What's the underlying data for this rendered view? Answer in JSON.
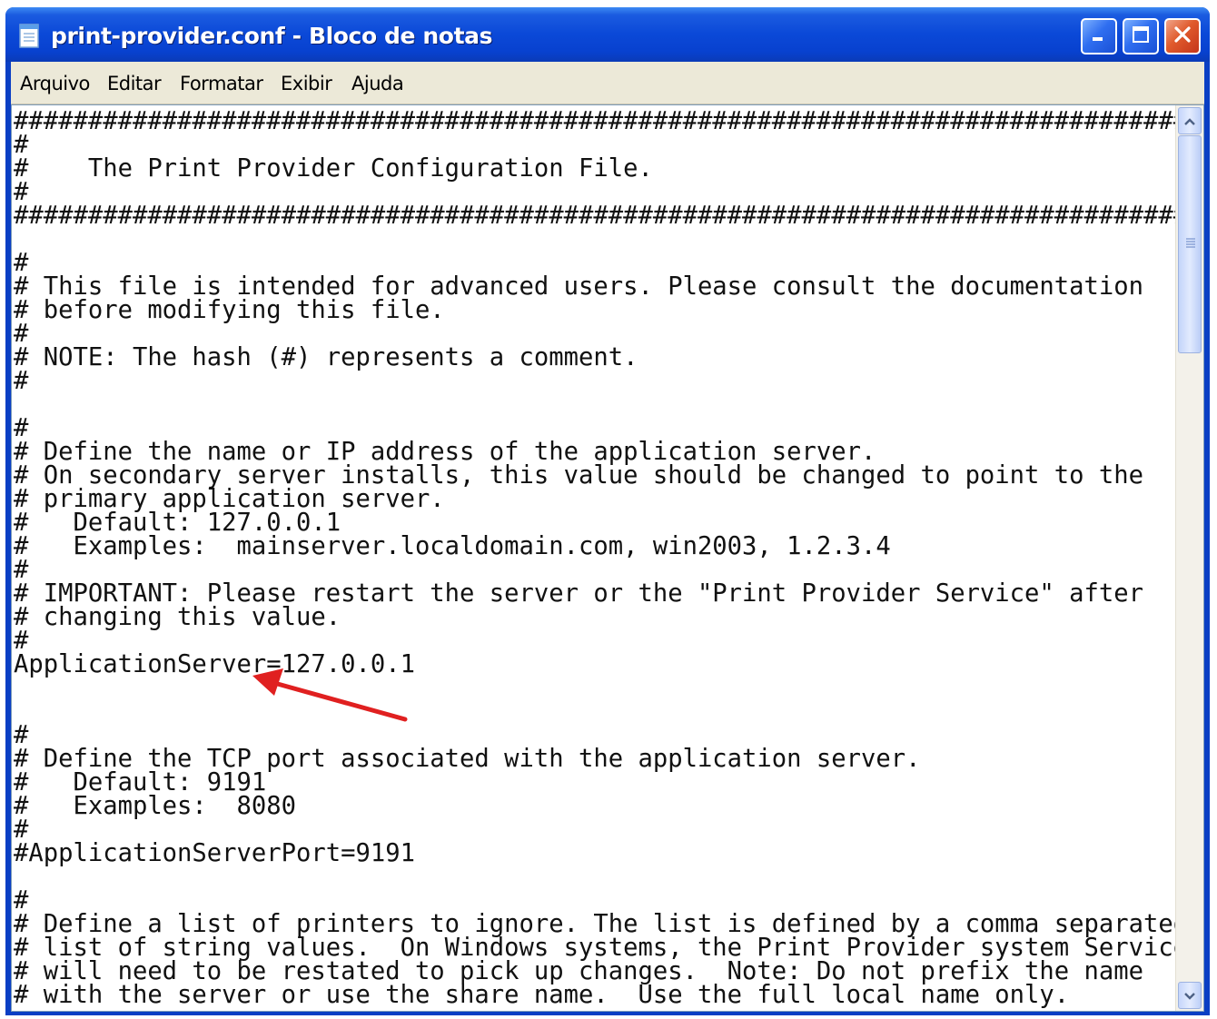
{
  "window": {
    "title": "print-provider.conf - Bloco de notas",
    "icon": "notepad-icon",
    "controls": [
      "minimize-icon",
      "maximize-icon",
      "close-icon"
    ]
  },
  "menu": {
    "items": [
      "Arquivo",
      "Editar",
      "Formatar",
      "Exibir",
      "Ajuda"
    ]
  },
  "document": {
    "lines": [
      "###############################################################################",
      "#",
      "#    The Print Provider Configuration File.",
      "#",
      "###############################################################################",
      "",
      "#",
      "# This file is intended for advanced users. Please consult the documentation",
      "# before modifying this file.",
      "#",
      "# NOTE: The hash (#) represents a comment.",
      "#",
      "",
      "#",
      "# Define the name or IP address of the application server.",
      "# On secondary server installs, this value should be changed to point to the",
      "# primary application server.",
      "#   Default: 127.0.0.1",
      "#   Examples:  mainserver.localdomain.com, win2003, 1.2.3.4",
      "#",
      "# IMPORTANT: Please restart the server or the \"Print Provider Service\" after",
      "# changing this value.",
      "#",
      "ApplicationServer=127.0.0.1",
      "",
      "",
      "#",
      "# Define the TCP port associated with the application server.",
      "#   Default: 9191",
      "#   Examples:  8080",
      "#",
      "#ApplicationServerPort=9191",
      "",
      "#",
      "# Define a list of printers to ignore. The list is defined by a comma separated",
      "# list of string values.  On Windows systems, the Print Provider system Service",
      "# will need to be restated to pick up changes.  Note: Do not prefix the name",
      "# with the server or use the share name.  Use the full local name only."
    ]
  },
  "annotation": {
    "arrow_color": "#e02020",
    "points_to": "ApplicationServer=127.0.0.1"
  },
  "colors": {
    "titlebar": "#0b49d8",
    "menubar": "#ece9d8",
    "close_button": "#e05a2c"
  }
}
